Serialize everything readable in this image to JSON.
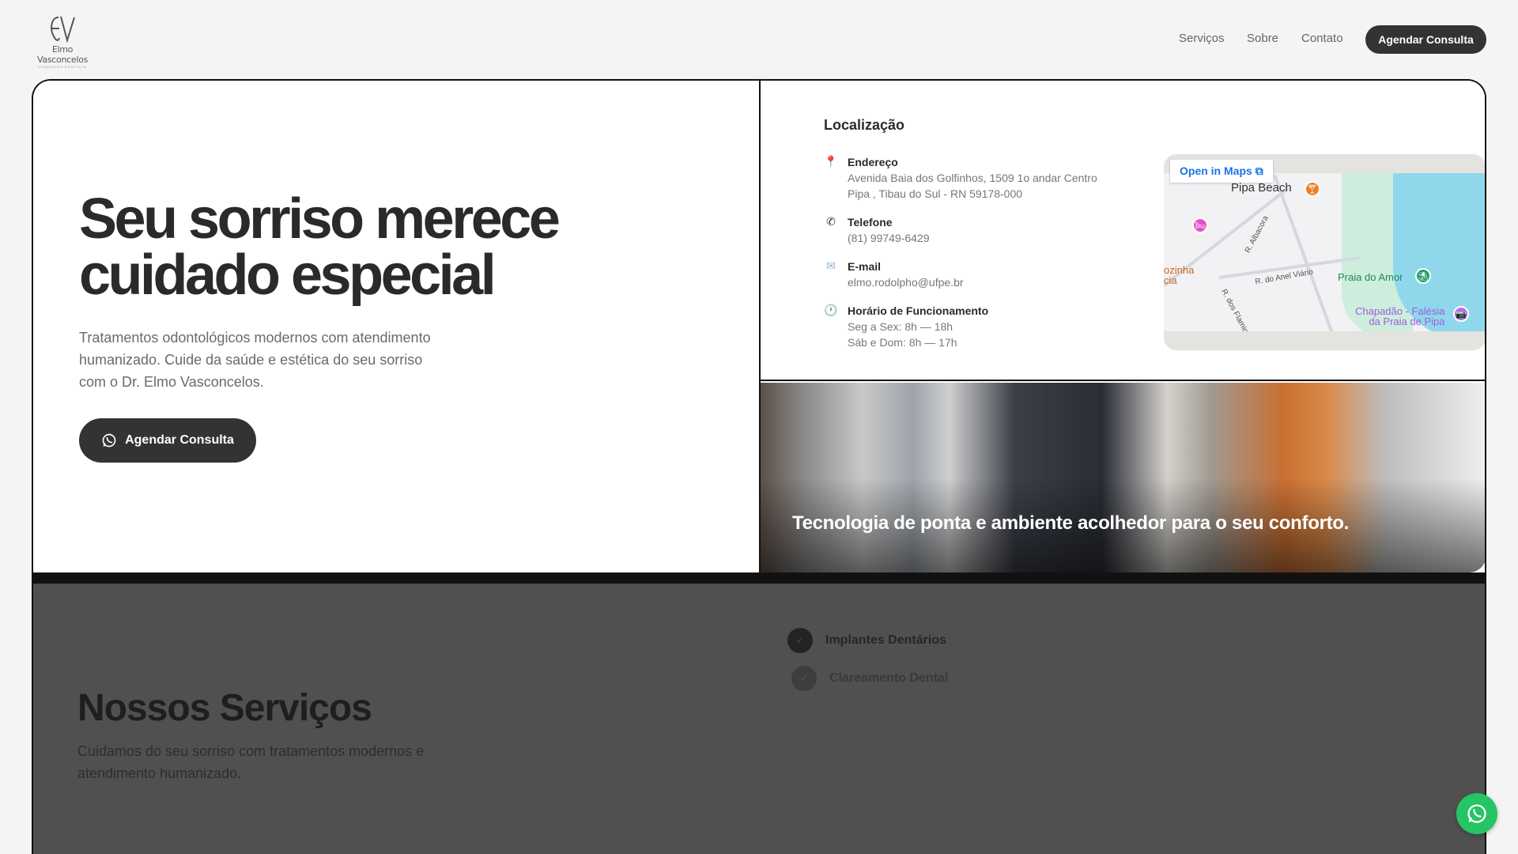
{
  "brand": {
    "name": "Elmo Vasconcelos",
    "tagline": "CIRURGIÃO-DENTISTA"
  },
  "nav": {
    "links": [
      "Serviços",
      "Sobre",
      "Contato"
    ],
    "cta": "Agendar Consulta"
  },
  "hero": {
    "title_line1": "Seu sorriso merece",
    "title_line2": "cuidado especial",
    "text": "Tratamentos odontológicos modernos com atendimento humanizado. Cuide da saúde e estética do seu sorriso com o Dr. Elmo Vasconcelos.",
    "cta": "Agendar Consulta"
  },
  "location": {
    "title": "Localização",
    "address_label": "Endereço",
    "address_line1": "Avenida Baia dos Golfinhos, 1509 1o andar Centro",
    "address_line2": "Pipa , Tibau do Sul - RN 59178-000",
    "phone_label": "Telefone",
    "phone": "(81) 99749-6429",
    "email_label": "E-mail",
    "email": "elmo.rodolpho@ufpe.br",
    "hours_label": "Horário de Funcionamento",
    "hours_weekdays": "Seg a Sex: 8h — 18h",
    "hours_weekend": "Sáb e Dom: 8h — 17h"
  },
  "map": {
    "open_label": "Open in Maps",
    "labels": {
      "pipa_beach": "Pipa Beach",
      "albacora": "R. Albacora",
      "anel": "R. do Anel Viário",
      "flamingos": "R. dos Flamingos",
      "cozinha1": "ozinha",
      "cozinha2": "cia",
      "praia_amor": "Praia do Amor",
      "chapadao1": "Chapadão - Falésia",
      "chapadao2": "da Praia de Pipa"
    },
    "colors": {
      "link": "#1a73e8",
      "sea": "#8fd8ec",
      "park": "#cdeedd"
    }
  },
  "photo": {
    "caption": "Tecnologia de ponta e ambiente acolhedor para o seu conforto."
  },
  "services": {
    "title": "Nossos Serviços",
    "text": "Cuidamos do seu sorriso com tratamentos modernos e atendimento humanizado.",
    "items": [
      "Implantes Dentários",
      "Clareamento Dental"
    ]
  },
  "colors": {
    "dark": "#333333",
    "whatsapp": "#25c464",
    "section_bg": "#505050"
  }
}
